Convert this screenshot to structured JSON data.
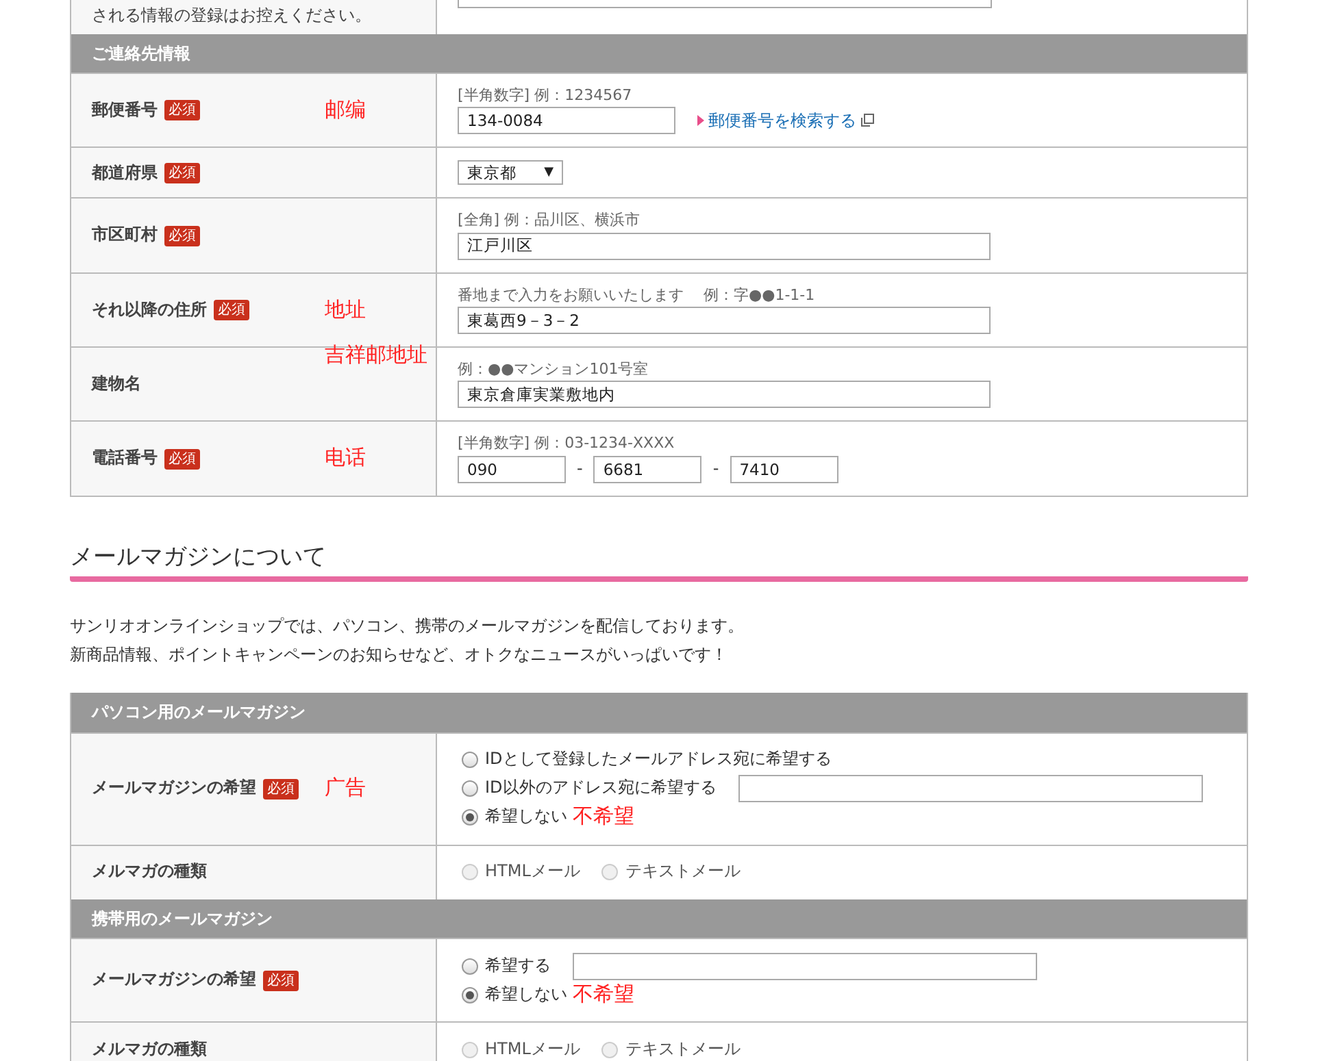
{
  "top_row": {
    "note": "される情報の登録はお控えください。"
  },
  "contact": {
    "title": "ご連絡先情報",
    "rows": [
      {
        "kind": "text",
        "label": "郵便番号",
        "required": true,
        "badge": "必須",
        "hint": "[半角数字] 例：1234567",
        "value": "134-0084",
        "link": "郵便番号を検索する",
        "annotation": "邮编"
      },
      {
        "kind": "select",
        "label": "都道府県",
        "required": true,
        "badge": "必須",
        "value": "東京都",
        "arrow": "▼"
      },
      {
        "kind": "text",
        "label": "市区町村",
        "required": true,
        "badge": "必須",
        "hint": "[全角] 例：品川区、横浜市",
        "value": "江戸川区"
      },
      {
        "kind": "text",
        "label": "それ以降の住所",
        "required": true,
        "badge": "必須",
        "hint": "番地まで入力をお願いいたします　 例：字●●1-1-1",
        "value": "東葛西9－3－2",
        "annotation": "地址"
      },
      {
        "kind": "text",
        "label": "建物名",
        "required": false,
        "hint": "例：●●マンション101号室",
        "value": "東京倉庫実業敷地内",
        "annotation": "吉祥邮地址"
      },
      {
        "kind": "phone",
        "label": "電話番号",
        "required": true,
        "badge": "必須",
        "hint": "[半角数字]  例：03-1234-XXXX",
        "parts": [
          "090",
          "6681",
          "7410"
        ],
        "separator": "-",
        "annotation": "电话"
      }
    ]
  },
  "mail": {
    "heading": "メールマガジンについて",
    "intro": [
      "サンリオオンラインショップでは、パソコン、携帯のメールマガジンを配信しております。",
      "新商品情報、ポイントキャンペーンのお知らせなど、オトクなニュースがいっぱいです！"
    ],
    "sections": [
      {
        "title": "パソコン用のメールマガジン",
        "rows": [
          {
            "label": "メールマガジンの希望",
            "required": true,
            "badge": "必須",
            "annotation": "广告",
            "kind": "stack",
            "options": [
              {
                "label": "IDとして登録したメールアドレス宛に希望する",
                "selected": false,
                "disabled": false
              },
              {
                "label": "ID以外のアドレス宛に希望する",
                "selected": false,
                "disabled": false,
                "field": true
              },
              {
                "label": "希望しない",
                "selected": true,
                "disabled": false,
                "note": "不希望"
              }
            ]
          },
          {
            "label": "メルマガの種類",
            "required": false,
            "kind": "inline",
            "options": [
              {
                "label": "HTMLメール",
                "selected": false,
                "disabled": true
              },
              {
                "label": "テキストメール",
                "selected": false,
                "disabled": true
              }
            ]
          }
        ]
      },
      {
        "title": "携帯用のメールマガジン",
        "rows": [
          {
            "label": "メールマガジンの希望",
            "required": true,
            "badge": "必須",
            "kind": "stack",
            "options": [
              {
                "label": "希望する",
                "selected": false,
                "disabled": false,
                "field": true
              },
              {
                "label": "希望しない",
                "selected": true,
                "disabled": false,
                "note": "不希望"
              }
            ]
          },
          {
            "label": "メルマガの種類",
            "required": false,
            "kind": "inline",
            "options": [
              {
                "label": "HTMLメール",
                "selected": false,
                "disabled": true
              },
              {
                "label": "テキストメール",
                "selected": false,
                "disabled": true
              }
            ]
          }
        ]
      }
    ]
  }
}
